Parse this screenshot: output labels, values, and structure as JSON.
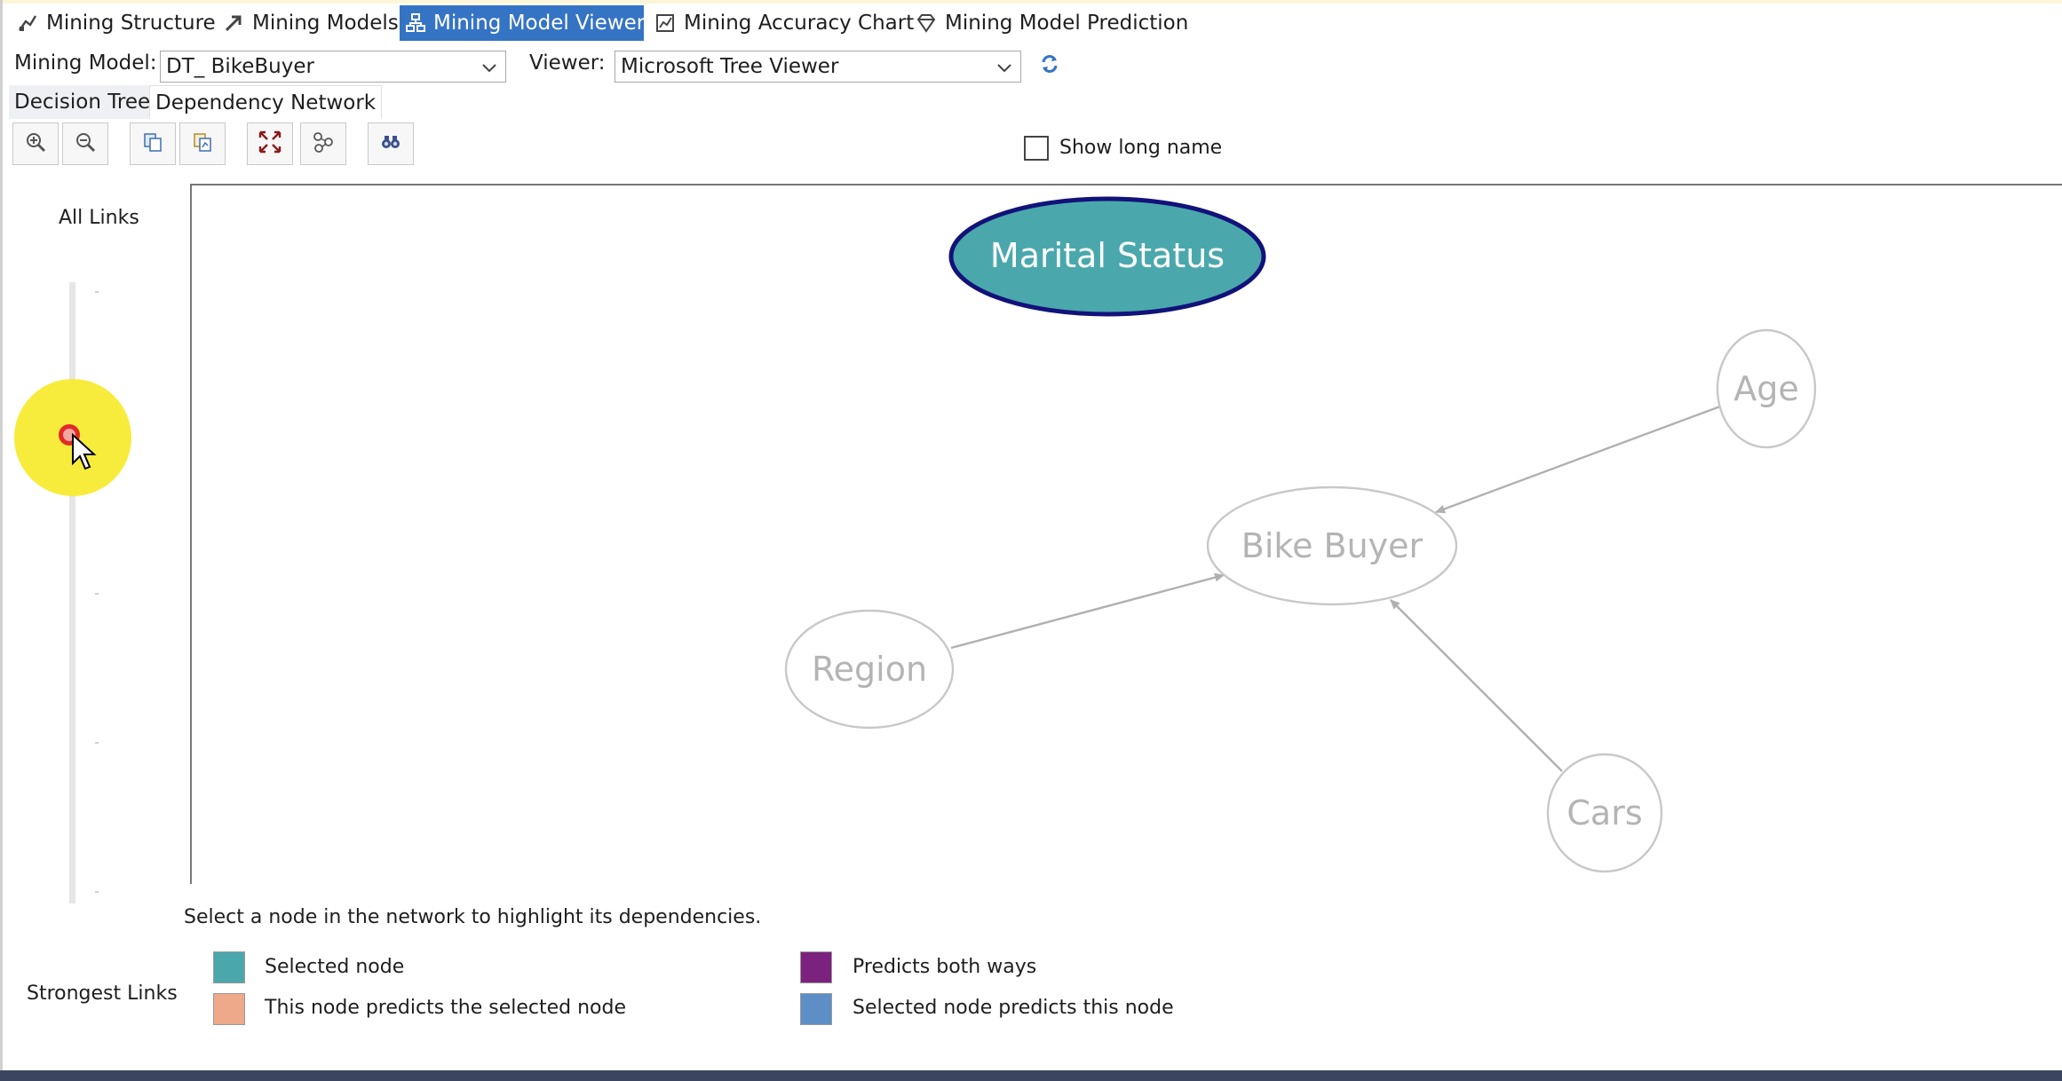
{
  "tabs": [
    {
      "label": "Mining Structure",
      "icon": "mining-structure-icon",
      "active": false
    },
    {
      "label": "Mining Models",
      "icon": "mining-models-icon",
      "active": false
    },
    {
      "label": "Mining Model Viewer",
      "icon": "mining-model-viewer-icon",
      "active": true
    },
    {
      "label": "Mining Accuracy Chart",
      "icon": "accuracy-chart-icon",
      "active": false
    },
    {
      "label": "Mining Model Prediction",
      "icon": "prediction-icon",
      "active": false
    }
  ],
  "model_selector": {
    "label": "Mining Model:",
    "value": "DT_ BikeBuyer"
  },
  "viewer_selector": {
    "label": "Viewer:",
    "value": "Microsoft Tree Viewer"
  },
  "subtabs": [
    {
      "label": "Decision Tree",
      "active": false
    },
    {
      "label": "Dependency Network",
      "active": true
    }
  ],
  "toolbar": {
    "buttons": [
      "zoom-in-icon",
      "zoom-out-icon",
      "copy-icon",
      "copy-graph-icon",
      "fit-to-window-icon",
      "layout-icon",
      "find-node-icon"
    ]
  },
  "show_long_name": {
    "label": "Show long name",
    "checked": false
  },
  "slider": {
    "top_label": "All Links",
    "bottom_label": "Strongest Links"
  },
  "network": {
    "nodes": [
      {
        "id": "marital",
        "label": "Marital Status",
        "selected": true
      },
      {
        "id": "age",
        "label": "Age",
        "selected": false
      },
      {
        "id": "bike",
        "label": "Bike Buyer",
        "selected": false
      },
      {
        "id": "region",
        "label": "Region",
        "selected": false
      },
      {
        "id": "cars",
        "label": "Cars",
        "selected": false
      }
    ],
    "edges": [
      {
        "from": "age",
        "to": "bike"
      },
      {
        "from": "region",
        "to": "bike"
      },
      {
        "from": "cars",
        "to": "bike"
      }
    ]
  },
  "hint": "Select a node in the network to highlight its dependencies.",
  "legend": [
    {
      "label": "Selected node",
      "color": "#4aa8ad"
    },
    {
      "label": "This node predicts the selected node",
      "color": "#eea98a"
    },
    {
      "label": "Predicts both ways",
      "color": "#7b227f"
    },
    {
      "label": "Selected node predicts this node",
      "color": "#5d8fc6"
    }
  ],
  "colors": {
    "accent": "#3574c4",
    "selected_node_fill": "#4aa8ad",
    "selected_node_border": "#12127a",
    "inactive_node": "#c8c8c8"
  }
}
